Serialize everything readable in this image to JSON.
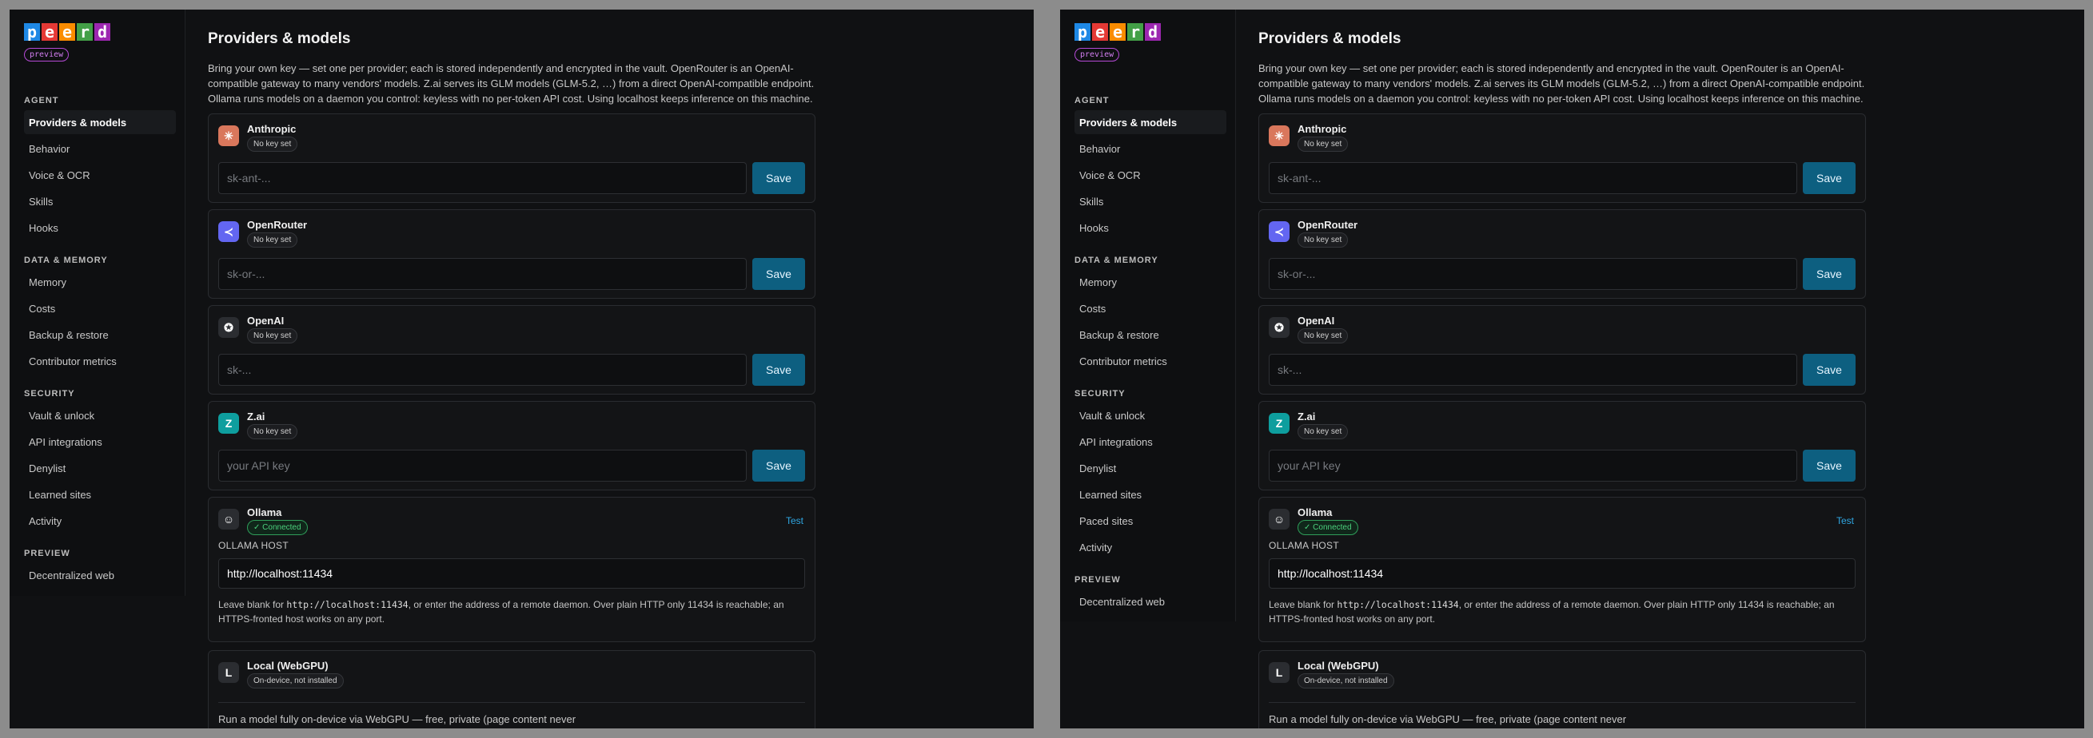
{
  "logo_letters": [
    {
      "char": "p",
      "color": "#1e88e5"
    },
    {
      "char": "e",
      "color": "#e53935"
    },
    {
      "char": "e",
      "color": "#fb8c00"
    },
    {
      "char": "r",
      "color": "#43a047"
    },
    {
      "char": "d",
      "color": "#9c27b0"
    }
  ],
  "preview_badge": "preview",
  "page_title": "Providers & models",
  "page_description": "Bring your own key — set one per provider; each is stored independently and encrypted in the vault. OpenRouter is an OpenAI-compatible gateway to many vendors' models. Z.ai serves its GLM models (GLM-5.2, …) from a direct OpenAI-compatible endpoint. Ollama runs models on a daemon you control: keyless with no per-token API cost. Using localhost keeps inference on this machine.",
  "panes": [
    {
      "nav": {
        "sections": [
          {
            "label": "AGENT",
            "items": [
              "Providers & models",
              "Behavior",
              "Voice & OCR",
              "Skills",
              "Hooks"
            ]
          },
          {
            "label": "DATA & MEMORY",
            "items": [
              "Memory",
              "Costs",
              "Backup & restore",
              "Contributor metrics"
            ]
          },
          {
            "label": "SECURITY",
            "items": [
              "Vault & unlock",
              "API integrations",
              "Denylist",
              "Learned sites",
              "Activity"
            ]
          },
          {
            "label": "PREVIEW",
            "items": [
              "Decentralized web"
            ]
          }
        ]
      }
    },
    {
      "nav": {
        "sections": [
          {
            "label": "AGENT",
            "items": [
              "Providers & models",
              "Behavior",
              "Voice & OCR",
              "Skills",
              "Hooks"
            ]
          },
          {
            "label": "DATA & MEMORY",
            "items": [
              "Memory",
              "Costs",
              "Backup & restore",
              "Contributor metrics"
            ]
          },
          {
            "label": "SECURITY",
            "items": [
              "Vault & unlock",
              "API integrations",
              "Denylist",
              "Learned sites",
              "Paced sites",
              "Activity"
            ]
          },
          {
            "label": "PREVIEW",
            "items": [
              "Decentralized web"
            ]
          }
        ]
      }
    }
  ],
  "providers": [
    {
      "name": "Anthropic",
      "status": "No key set",
      "placeholder": "sk-ant-...",
      "save": "Save",
      "icon": "anthropic-icon",
      "icon_glyph": "✳",
      "icon_color": "#d9775c"
    },
    {
      "name": "OpenRouter",
      "status": "No key set",
      "placeholder": "sk-or-...",
      "save": "Save",
      "icon": "openrouter-icon",
      "icon_glyph": "≺",
      "icon_color": "#6366f1"
    },
    {
      "name": "OpenAI",
      "status": "No key set",
      "placeholder": "sk-...",
      "save": "Save",
      "icon": "openai-icon",
      "icon_glyph": "✪",
      "icon_color": "#2b2d31"
    },
    {
      "name": "Z.ai",
      "status": "No key set",
      "placeholder": "your API key",
      "save": "Save",
      "icon": "zai-icon",
      "icon_glyph": "Z",
      "icon_color": "#0e9e9e"
    }
  ],
  "ollama": {
    "name": "Ollama",
    "status": "✓ Connected",
    "test": "Test",
    "host_label": "OLLAMA HOST",
    "host_value": "http://localhost:11434",
    "help_before": "Leave blank for ",
    "help_code": "http://localhost:11434",
    "help_after": ", or enter the address of a remote daemon. Over plain HTTP only 11434 is reachable; an HTTPS-fronted host works on any port.",
    "icon": "ollama-icon",
    "icon_glyph": "☺",
    "icon_color": "#2b2d31"
  },
  "local": {
    "name": "Local (WebGPU)",
    "status": "On-device, not installed",
    "description": "Run a model fully on-device via WebGPU — free, private (page content never",
    "icon": "local-webgpu-icon",
    "icon_glyph": "L",
    "icon_color": "#2b2d31"
  }
}
